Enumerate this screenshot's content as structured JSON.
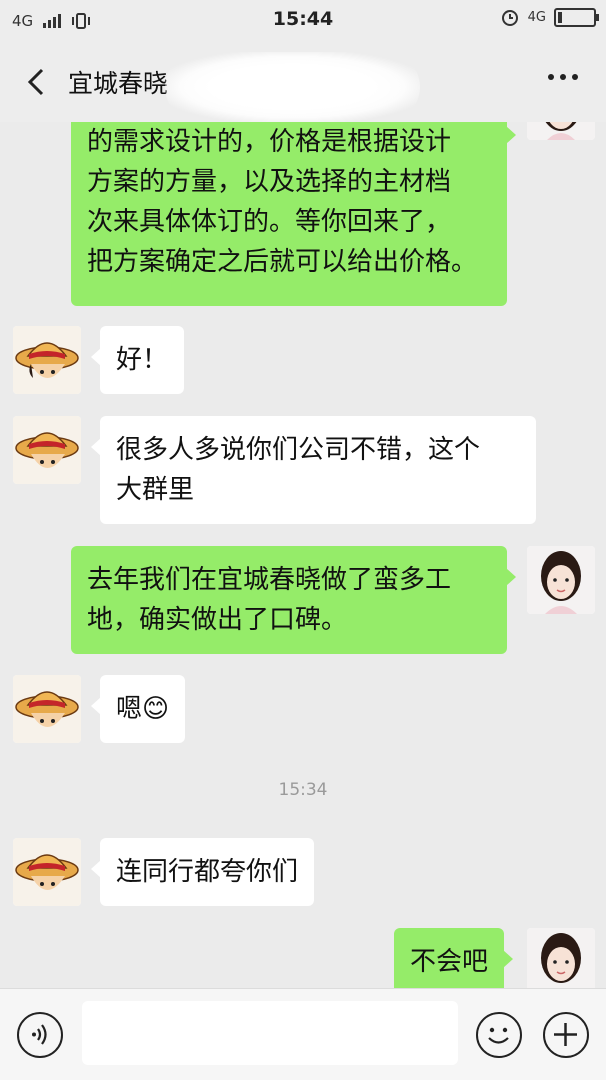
{
  "status_bar": {
    "network_left": "4G",
    "time": "15:44",
    "network_right": "4G",
    "battery_level": 0.12
  },
  "nav": {
    "title": "宜城春晓"
  },
  "messages": [
    {
      "side": "right",
      "lines": [
        "的需求设计的，价格是根据设计",
        "方案的方量，以及选择的主材档",
        "次来具体体订的。等你回来了，",
        "把方案确定之后就可以给出价格。"
      ]
    },
    {
      "side": "left",
      "lines": [
        "好！"
      ]
    },
    {
      "side": "left",
      "lines": [
        "很多人多说你们公司不错，这个",
        "大群里"
      ]
    },
    {
      "side": "right",
      "lines": [
        "去年我们在宜城春晓做了蛮多工",
        "地，确实做出了口碑。"
      ]
    },
    {
      "side": "left",
      "lines": [
        "嗯😊"
      ]
    },
    {
      "side": "time",
      "text": "15:34"
    },
    {
      "side": "left",
      "lines": [
        "连同行都夸你们"
      ]
    },
    {
      "side": "right",
      "lines": [
        "不会吧"
      ]
    }
  ],
  "input_bar": {
    "text_value": ""
  },
  "icons": {
    "back": "back-arrow-icon",
    "more": "more-dots-icon",
    "voice": "voice-icon",
    "emoji": "emoji-icon",
    "plus": "plus-icon"
  },
  "colors": {
    "chat_background": "#ebebeb",
    "own_bubble": "#95ec69",
    "other_bubble": "#ffffff"
  }
}
